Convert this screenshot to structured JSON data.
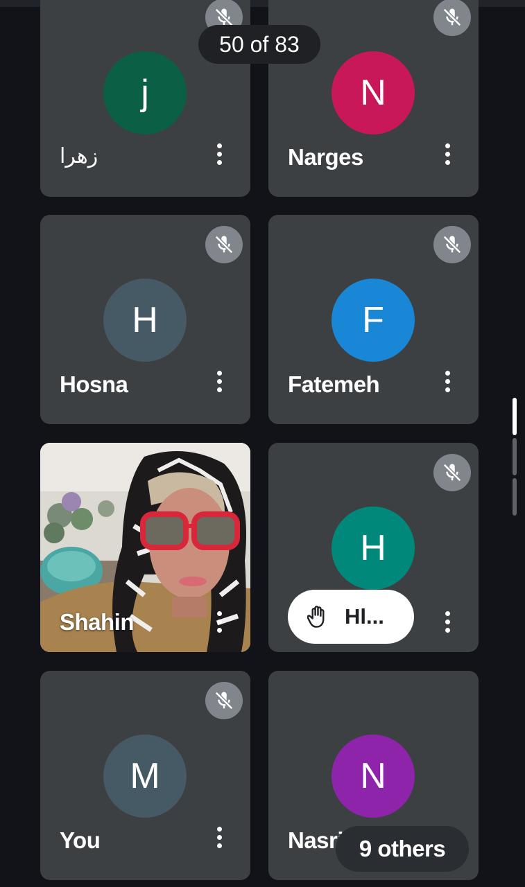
{
  "header": {
    "participant_counter": "50 of 83"
  },
  "tiles": [
    {
      "name": "زهرا",
      "initial": "j",
      "avatar_color": "#0b5f45",
      "muted": true
    },
    {
      "name": "Narges",
      "initial": "N",
      "avatar_color": "#c8185a",
      "muted": true
    },
    {
      "name": "Hosna",
      "initial": "H",
      "avatar_color": "#455a64",
      "muted": true
    },
    {
      "name": "Fatemeh",
      "initial": "F",
      "avatar_color": "#1a87d6",
      "muted": true
    },
    {
      "name": "Shahin",
      "video": true
    },
    {
      "initial": "H",
      "avatar_color": "#00897b",
      "muted": true,
      "raised_hand_label": "Hl..."
    },
    {
      "name": "You",
      "initial": "M",
      "avatar_color": "#455a64",
      "muted": true
    },
    {
      "name": "Nasrin",
      "initial": "N",
      "avatar_color": "#8e24aa"
    }
  ],
  "overflow": {
    "label": "9 others"
  },
  "colors": {
    "background": "#111318",
    "tile": "#3c4043",
    "mute_badge": "#80868b"
  },
  "icons": {
    "mute": "mic-off-icon",
    "more": "more-vertical-icon",
    "hand": "raised-hand-icon"
  }
}
